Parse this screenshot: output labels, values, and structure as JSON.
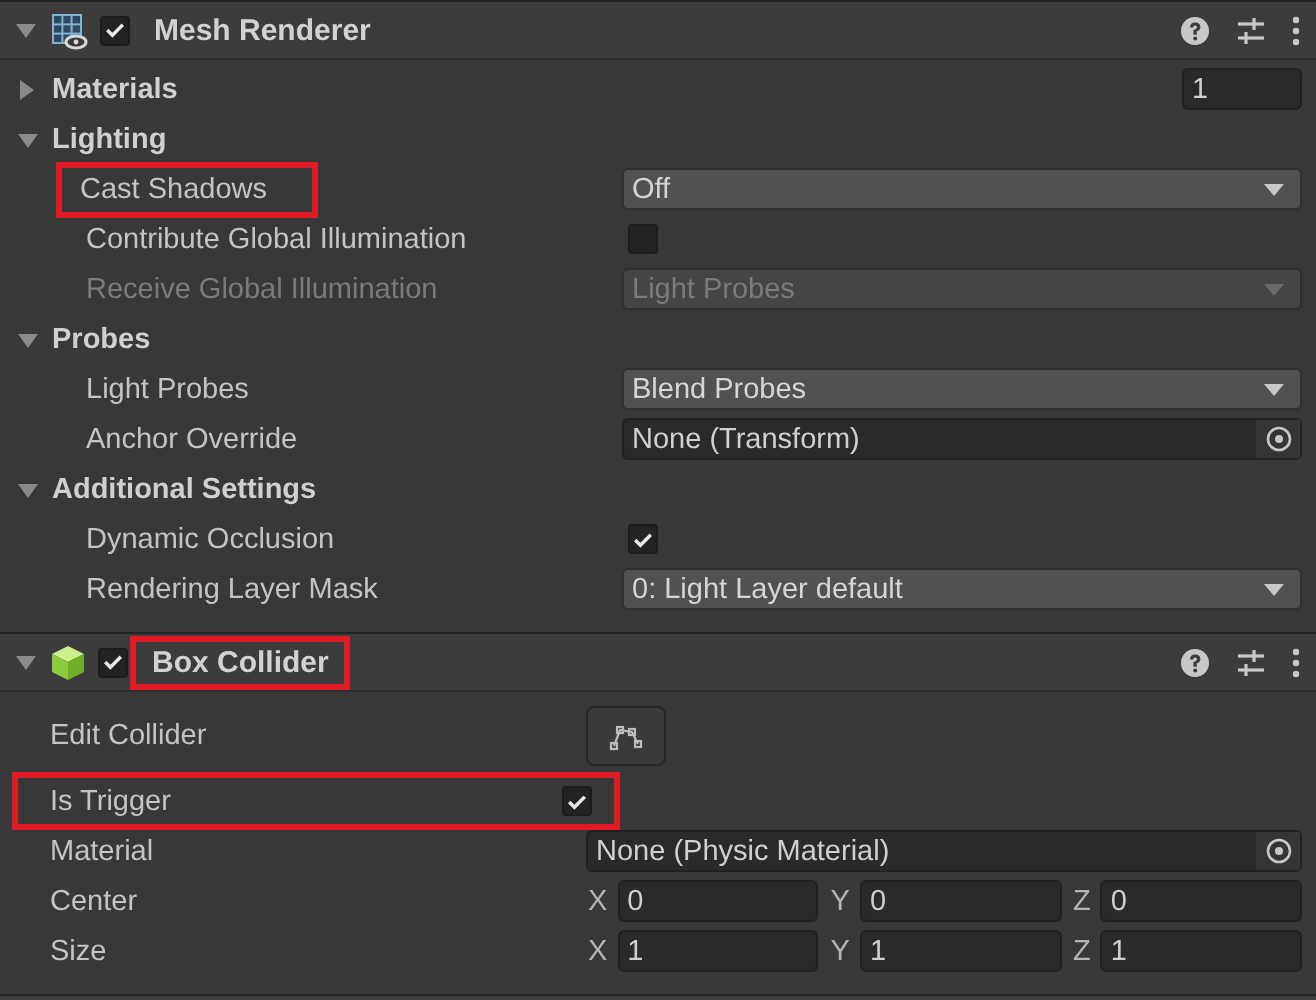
{
  "components": [
    {
      "title": "Mesh Renderer",
      "enabled": true,
      "expanded": true,
      "highlighted": false,
      "rows": [
        {
          "kind": "foldout",
          "label": "Materials",
          "expanded": false,
          "value": "1"
        },
        {
          "kind": "foldout",
          "label": "Lighting",
          "expanded": true,
          "children": [
            {
              "kind": "dropdown",
              "label": "Cast Shadows",
              "value": "Off",
              "disabled": false,
              "highlighted": true
            },
            {
              "kind": "checkbox",
              "label": "Contribute Global Illumination",
              "checked": false,
              "disabled": false,
              "highlighted": false
            },
            {
              "kind": "dropdown",
              "label": "Receive Global Illumination",
              "value": "Light Probes",
              "disabled": true,
              "highlighted": false
            }
          ]
        },
        {
          "kind": "foldout",
          "label": "Probes",
          "expanded": true,
          "children": [
            {
              "kind": "dropdown",
              "label": "Light Probes",
              "value": "Blend Probes",
              "disabled": false,
              "highlighted": false
            },
            {
              "kind": "object",
              "label": "Anchor Override",
              "value": "None (Transform)",
              "disabled": false,
              "highlighted": false
            }
          ]
        },
        {
          "kind": "foldout",
          "label": "Additional Settings",
          "expanded": true,
          "children": [
            {
              "kind": "checkbox",
              "label": "Dynamic Occlusion",
              "checked": true,
              "disabled": false,
              "highlighted": false
            },
            {
              "kind": "dropdown",
              "label": "Rendering Layer Mask",
              "value": "0: Light Layer default",
              "disabled": false,
              "highlighted": false
            }
          ]
        }
      ]
    },
    {
      "title": "Box Collider",
      "enabled": true,
      "expanded": true,
      "highlighted": true,
      "rows": [
        {
          "kind": "edit",
          "label": "Edit Collider",
          "disabled": false,
          "highlighted": false
        },
        {
          "kind": "checkbox",
          "label": "Is Trigger",
          "checked": true,
          "disabled": false,
          "highlighted": true
        },
        {
          "kind": "object",
          "label": "Material",
          "value": "None (Physic Material)",
          "disabled": false,
          "highlighted": false
        },
        {
          "kind": "vector3",
          "label": "Center",
          "disabled": false,
          "highlighted": false,
          "values": [
            {
              "axis": "X",
              "value": "0"
            },
            {
              "axis": "Y",
              "value": "0"
            },
            {
              "axis": "Z",
              "value": "0"
            }
          ]
        },
        {
          "kind": "vector3",
          "label": "Size",
          "disabled": false,
          "highlighted": false,
          "values": [
            {
              "axis": "X",
              "value": "1"
            },
            {
              "axis": "Y",
              "value": "1"
            },
            {
              "axis": "Z",
              "value": "1"
            }
          ]
        }
      ]
    }
  ]
}
